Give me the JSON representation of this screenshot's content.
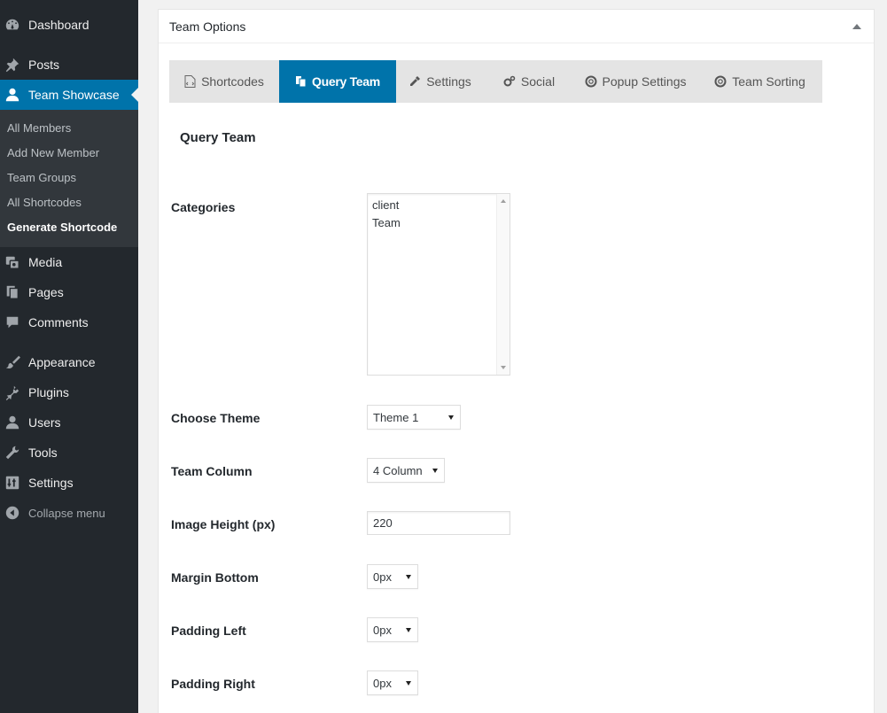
{
  "sidebar": {
    "items": [
      {
        "label": "Dashboard",
        "icon": "dashboard-icon"
      },
      {
        "label": "Posts",
        "icon": "pin-icon"
      },
      {
        "label": "Team Showcase",
        "icon": "user-icon",
        "current": true
      },
      {
        "label": "Media",
        "icon": "media-icon"
      },
      {
        "label": "Pages",
        "icon": "pages-icon"
      },
      {
        "label": "Comments",
        "icon": "comment-icon"
      },
      {
        "label": "Appearance",
        "icon": "brush-icon"
      },
      {
        "label": "Plugins",
        "icon": "plug-icon"
      },
      {
        "label": "Users",
        "icon": "users-icon"
      },
      {
        "label": "Tools",
        "icon": "wrench-icon"
      },
      {
        "label": "Settings",
        "icon": "sliders-icon"
      }
    ],
    "submenu": [
      "All Members",
      "Add New Member",
      "Team Groups",
      "All Shortcodes",
      "Generate Shortcode"
    ],
    "collapse_label": "Collapse menu"
  },
  "postbox": {
    "title": "Team Options",
    "tabs": [
      {
        "label": "Shortcodes",
        "icon": "code-file-icon"
      },
      {
        "label": "Query Team",
        "icon": "copy-icon",
        "active": true
      },
      {
        "label": "Settings",
        "icon": "eyedropper-icon"
      },
      {
        "label": "Social",
        "icon": "cogs-icon"
      },
      {
        "label": "Popup Settings",
        "icon": "lifebuoy-icon"
      },
      {
        "label": "Team Sorting",
        "icon": "lifebuoy-icon"
      }
    ],
    "section_title": "Query Team"
  },
  "form": {
    "categories_label": "Categories",
    "categories": [
      "client",
      "Team"
    ],
    "theme_label": "Choose Theme",
    "theme_value": "Theme 1",
    "column_label": "Team Column",
    "column_value": "4 Column",
    "image_height_label": "Image Height (px)",
    "image_height_value": "220",
    "margin_bottom_label": "Margin Bottom",
    "margin_bottom_value": "0px",
    "padding_left_label": "Padding Left",
    "padding_left_value": "0px",
    "padding_right_label": "Padding Right",
    "padding_right_value": "0px"
  },
  "colors": {
    "sidebar_bg": "#23282d",
    "submenu_bg": "#32373c",
    "accent": "#0073aa",
    "tabs_bg": "#e4e4e4"
  }
}
